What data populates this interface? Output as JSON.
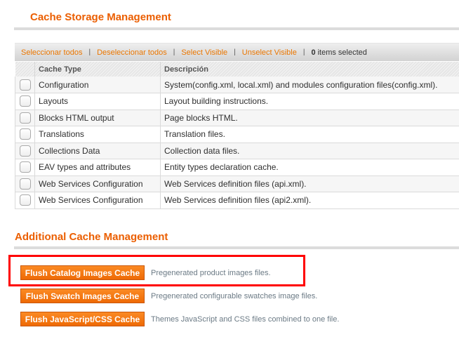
{
  "cache_storage": {
    "title": "Cache Storage Management",
    "massaction": {
      "select_all": "Seleccionar todos",
      "unselect_all": "Deseleccionar todos",
      "select_visible": "Select Visible",
      "unselect_visible": "Unselect Visible",
      "separator": "|",
      "selected_count": "0",
      "selected_label": "items selected"
    },
    "columns": [
      "Cache Type",
      "Descripción"
    ],
    "rows": [
      {
        "type": "Configuration",
        "description": "System(config.xml, local.xml) and modules configuration files(config.xml).",
        "checked": false
      },
      {
        "type": "Layouts",
        "description": "Layout building instructions.",
        "checked": false
      },
      {
        "type": "Blocks HTML output",
        "description": "Page blocks HTML.",
        "checked": false
      },
      {
        "type": "Translations",
        "description": "Translation files.",
        "checked": false
      },
      {
        "type": "Collections Data",
        "description": "Collection data files.",
        "checked": false
      },
      {
        "type": "EAV types and attributes",
        "description": "Entity types declaration cache.",
        "checked": false
      },
      {
        "type": "Web Services Configuration",
        "description": "Web Services definition files (api.xml).",
        "checked": false
      },
      {
        "type": "Web Services Configuration",
        "description": "Web Services definition files (api2.xml).",
        "checked": false
      }
    ]
  },
  "additional_cache": {
    "title": "Additional Cache Management",
    "actions": [
      {
        "label": "Flush Catalog Images Cache",
        "description": "Pregenerated product images files.",
        "highlighted": true
      },
      {
        "label": "Flush Swatch Images Cache",
        "description": "Pregenerated configurable swatches image files.",
        "highlighted": false
      },
      {
        "label": "Flush JavaScript/CSS Cache",
        "description": "Themes JavaScript and CSS files combined to one file.",
        "highlighted": false
      }
    ]
  },
  "colors": {
    "title_orange": "#eb5e00",
    "link_orange": "#ea7601",
    "button_orange": "#f07a12",
    "highlight_red": "#ff0000"
  }
}
